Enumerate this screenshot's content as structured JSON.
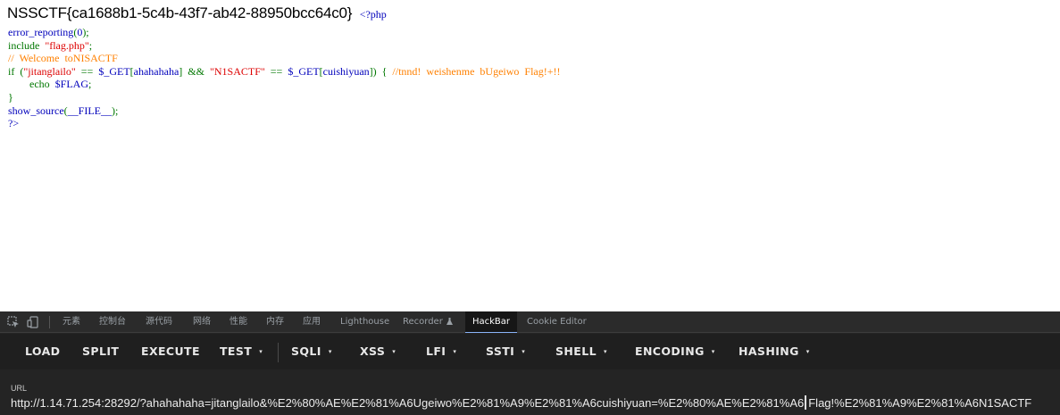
{
  "page": {
    "flag": "NSSCTF{ca1688b1-5c4b-43f7-ab42-88950bcc64c0}",
    "php_open": "<?php",
    "code_lines": [
      [
        {
          "t": "error_reporting",
          "c": "default"
        },
        {
          "t": "(",
          "c": "keyword"
        },
        {
          "t": "0",
          "c": "default"
        },
        {
          "t": ");",
          "c": "keyword"
        }
      ],
      [
        {
          "t": "include  ",
          "c": "keyword"
        },
        {
          "t": "\"flag.php\"",
          "c": "string"
        },
        {
          "t": ";",
          "c": "keyword"
        }
      ],
      [
        {
          "t": "//  Welcome  toNISACTF",
          "c": "comment"
        }
      ],
      [
        {
          "t": "if  (",
          "c": "keyword"
        },
        {
          "t": "\"jitanglailo\"",
          "c": "string"
        },
        {
          "t": "  ==  ",
          "c": "keyword"
        },
        {
          "t": "$_GET",
          "c": "default"
        },
        {
          "t": "[",
          "c": "keyword"
        },
        {
          "t": "ahahahaha",
          "c": "default"
        },
        {
          "t": "]  &&  ",
          "c": "keyword"
        },
        {
          "t": "\"N1SACTF\"",
          "c": "string"
        },
        {
          "t": "  ==  ",
          "c": "keyword"
        },
        {
          "t": "$_GET",
          "c": "default"
        },
        {
          "t": "[",
          "c": "keyword"
        },
        {
          "t": "cuishiyuan",
          "c": "default"
        },
        {
          "t": "])  {  ",
          "c": "keyword"
        },
        {
          "t": "//tnnd!  weishenme  bUgeiwo  Flag!+!!",
          "c": "comment"
        }
      ],
      [
        {
          "t": "        echo  ",
          "c": "keyword"
        },
        {
          "t": "$FLAG",
          "c": "default"
        },
        {
          "t": ";",
          "c": "keyword"
        }
      ],
      [
        {
          "t": "}",
          "c": "keyword"
        }
      ],
      [
        {
          "t": "show_source",
          "c": "default"
        },
        {
          "t": "(",
          "c": "keyword"
        },
        {
          "t": "__FILE__",
          "c": "default"
        },
        {
          "t": ");",
          "c": "keyword"
        }
      ],
      [
        {
          "t": "?>",
          "c": "default"
        }
      ]
    ]
  },
  "devtools": {
    "icons": [
      "inspect-icon",
      "device-toggle-icon",
      "recorder-icon"
    ],
    "tabs": [
      "元素",
      "控制台",
      "源代码",
      "网络",
      "性能",
      "内存",
      "应用",
      "Lighthouse",
      "Recorder",
      "HackBar",
      "Cookie Editor"
    ],
    "active_tab": "HackBar"
  },
  "hackbar": {
    "buttons": [
      "LOAD",
      "SPLIT",
      "EXECUTE",
      "TEST",
      "SQLI",
      "XSS",
      "LFI",
      "SSTI",
      "SHELL",
      "ENCODING",
      "HASHING"
    ],
    "dropdown_arrow": "▾",
    "url_label": "URL",
    "url_before_caret": "http://1.14.71.254:28292/?ahahahaha=jitanglailo&%E2%80%AE%E2%81%A6Ugeiwo%E2%81%A9%E2%81%A6cuishiyuan=%E2%80%AE%E2%81%A6",
    "url_after_caret": "Flag!%E2%81%A9%E2%81%A6N1SACTF"
  },
  "colors": {
    "php_default": "#0000bb",
    "php_keyword": "#007700",
    "php_string": "#dd0000",
    "php_comment": "#ff8000",
    "devtools_bg": "#242424",
    "active_tab_underline": "#8ab4f8"
  }
}
